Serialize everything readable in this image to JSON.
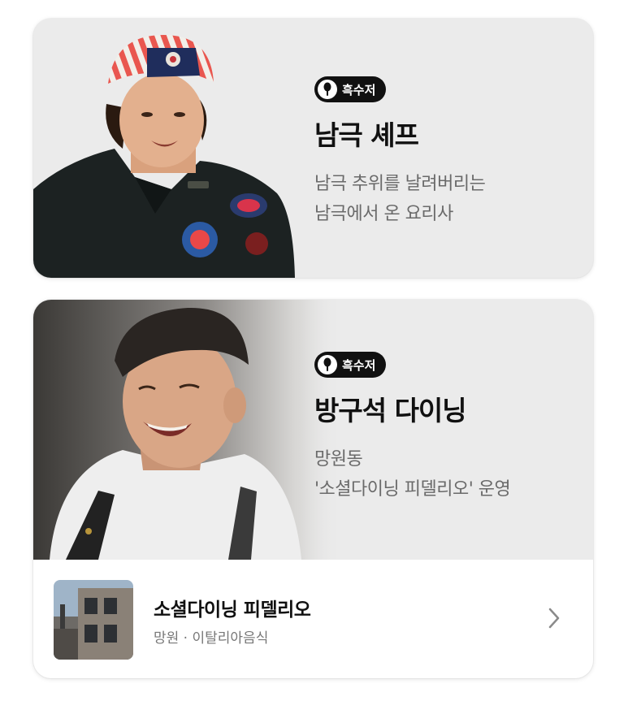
{
  "cards": [
    {
      "badge": "흑수저",
      "name": "남극 셰프",
      "desc_lines": [
        "남극 추위를 날려버리는",
        "남극에서 온 요리사"
      ]
    },
    {
      "badge": "흑수저",
      "name": "방구석 다이닝",
      "desc_lines": [
        "망원동",
        "'소셜다이닝 피델리오' 운영"
      ],
      "restaurant": {
        "name": "소셜다이닝 피델리오",
        "meta": "망원 · 이탈리아음식"
      }
    }
  ],
  "icons": {
    "badge": "spoon-icon",
    "restaurant_link": "chevron-right-icon"
  },
  "colors": {
    "card_bg": "#ebebeb",
    "badge_bg": "#111111",
    "title": "#111111",
    "desc": "#6a6a6a",
    "meta": "#777777"
  }
}
